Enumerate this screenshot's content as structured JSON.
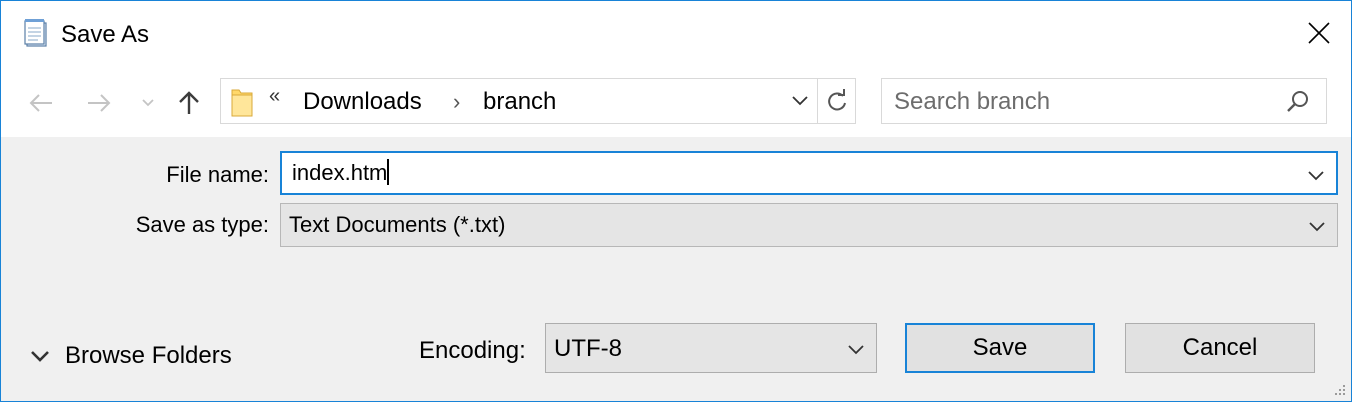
{
  "window": {
    "title": "Save As",
    "icon": "notepad-icon",
    "accent_color": "#1883d7"
  },
  "nav": {
    "back_icon": "arrow-left-icon",
    "forward_icon": "arrow-right-icon",
    "recent_icon": "chevron-down-icon",
    "up_icon": "arrow-up-icon"
  },
  "address_bar": {
    "overflow": "«",
    "breadcrumbs": [
      "Downloads",
      "branch"
    ],
    "separator": "›"
  },
  "search": {
    "placeholder": "Search branch"
  },
  "form": {
    "file_name_label": "File name:",
    "file_name_value": "index.htm",
    "save_type_label": "Save as type:",
    "save_type_value": "Text Documents (*.txt)"
  },
  "footer": {
    "browse_folders_label": "Browse Folders",
    "encoding_label": "Encoding:",
    "encoding_value": "UTF-8",
    "save_label": "Save",
    "cancel_label": "Cancel"
  }
}
